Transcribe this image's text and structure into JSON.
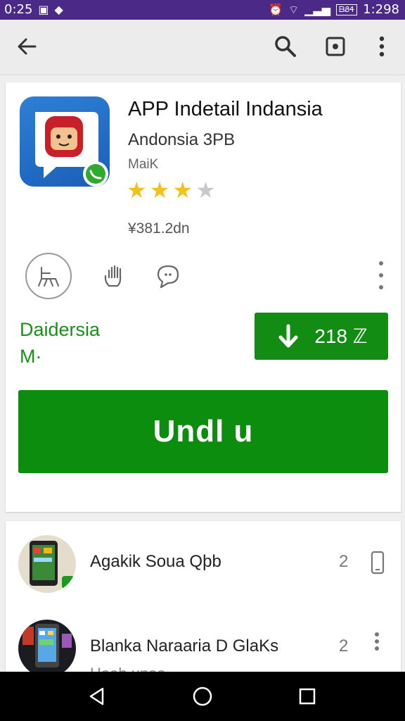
{
  "status_bar": {
    "time_left": "0:25",
    "time_right": "1:298",
    "battery_text": "ᗷᏰᏎ"
  },
  "toolbar": {
    "back_icon": "arrow-left",
    "search_icon": "search",
    "cast_icon": "screen-square",
    "more_icon": "dots-vertical"
  },
  "app": {
    "title": "APP Indetail Indansia",
    "developer": "Andonsia 3PB",
    "subtitle": "MaiK",
    "rating_stars": 3,
    "rating_max": 4,
    "size": "¥381.2dn",
    "green_line1": "Daidersia",
    "green_line2": "M·",
    "download_count": "218 ℤ",
    "install_label": "Undl u"
  },
  "actions": [
    {
      "name": "chair-icon"
    },
    {
      "name": "hand-icon"
    },
    {
      "name": "chat-icon"
    }
  ],
  "similar": [
    {
      "title": "Agakik Soua Qþb",
      "count": "2",
      "sub": ""
    },
    {
      "title": "Blanka Naraaria D GlaKs",
      "count": "2",
      "sub": "Haab unaa"
    }
  ],
  "colors": {
    "status_bar": "#4a2a86",
    "green": "#0d8d0d",
    "star": "#f4c01e"
  }
}
